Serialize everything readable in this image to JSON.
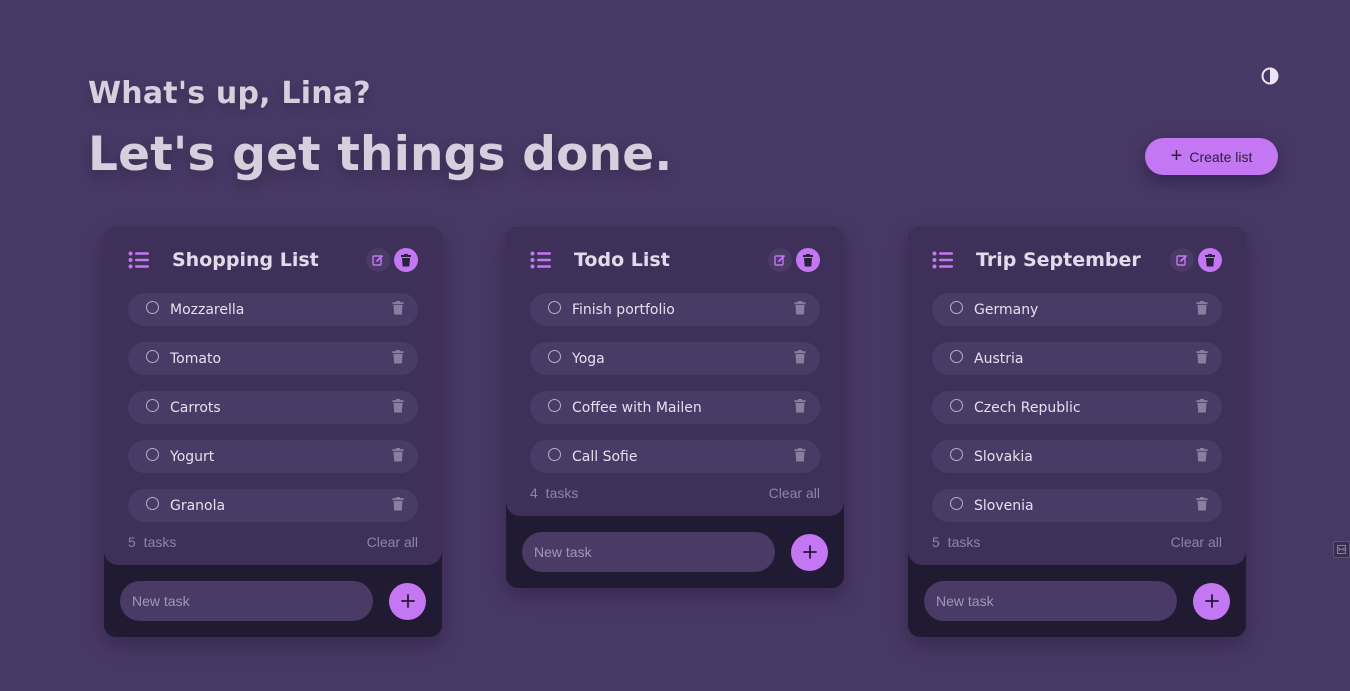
{
  "header": {
    "greeting": "What's up, Lina?",
    "headline": "Let's get things done.",
    "create_button_label": "Create list",
    "create_button_icon": "plus-icon",
    "theme_icon": "contrast-icon"
  },
  "colors": {
    "background": "#483865",
    "accent": "#c377f2",
    "card_top": "#3e3058",
    "card_bottom": "#211a33",
    "pill": "#4a3a66"
  },
  "new_task_placeholder": "New task",
  "lists": [
    {
      "title": "Shopping List",
      "tasks": [
        "Mozzarella",
        "Tomato",
        "Carrots",
        "Yogurt",
        "Granola"
      ],
      "count_text": "5  tasks",
      "clear_label": "Clear all"
    },
    {
      "title": "Todo List",
      "tasks": [
        "Finish portfolio",
        "Yoga",
        "Coffee with Mailen",
        "Call Sofie"
      ],
      "count_text": "4  tasks",
      "clear_label": "Clear all"
    },
    {
      "title": "Trip September",
      "tasks": [
        "Germany",
        "Austria",
        "Czech Republic",
        "Slovakia",
        "Slovenia"
      ],
      "count_text": "5  tasks",
      "clear_label": "Clear all"
    }
  ]
}
